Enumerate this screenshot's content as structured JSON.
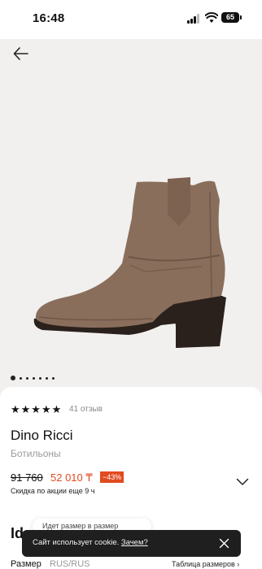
{
  "status": {
    "time": "16:48",
    "battery": "65"
  },
  "product": {
    "rating_stars": "★★★★★",
    "reviews": "41 отзыв",
    "brand": "Dino Ricci",
    "category": "Ботильоны",
    "old_price": "91 760",
    "new_price": "52 010 ₸",
    "discount": "−43%",
    "promo": "Скидка по акции еще 9 ч",
    "gallery_dots": 7,
    "gallery_active_index": 0
  },
  "size_section": {
    "heading": "Id",
    "tooltip": "Идет размер в размер",
    "size_label": "Размер",
    "size_value": "RUS/RUS",
    "size_table_link": "Таблица размеров ›"
  },
  "cookie": {
    "text": "Сайт использует cookie.",
    "link": "Зачем?"
  },
  "colors": {
    "accent": "#e24a1f",
    "boot": "#8a6e5c",
    "sole": "#2a211c"
  }
}
